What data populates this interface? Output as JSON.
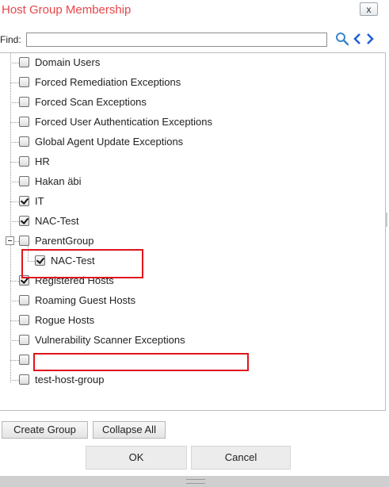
{
  "dialog": {
    "title": "Host Group Membership",
    "close_label": "x"
  },
  "find": {
    "label": "Find:",
    "value": "",
    "placeholder": "",
    "icons": [
      "search-icon",
      "previous-icon",
      "next-icon"
    ]
  },
  "tree": {
    "items": [
      {
        "label": "Domain Users",
        "checked": false
      },
      {
        "label": "Forced Remediation Exceptions",
        "checked": false
      },
      {
        "label": "Forced Scan Exceptions",
        "checked": false
      },
      {
        "label": "Forced User Authentication Exceptions",
        "checked": false
      },
      {
        "label": "Global Agent Update Exceptions",
        "checked": false
      },
      {
        "label": "HR",
        "checked": false
      },
      {
        "label": "Hakan äbi",
        "checked": false
      },
      {
        "label": "IT",
        "checked": true
      },
      {
        "label": "NAC-Test",
        "checked": true
      },
      {
        "label": "ParentGroup",
        "checked": false,
        "expanded": true,
        "children": [
          {
            "label": "NAC-Test",
            "checked": true
          }
        ]
      },
      {
        "label": "Registered Hosts",
        "checked": true
      },
      {
        "label": "Roaming Guest Hosts",
        "checked": false
      },
      {
        "label": "Rogue Hosts",
        "checked": false
      },
      {
        "label": "Vulnerability Scanner Exceptions",
        "checked": false
      },
      {
        "label": "",
        "checked": false
      },
      {
        "label": "test-host-group",
        "checked": false
      }
    ]
  },
  "buttons": {
    "create_group": "Create Group",
    "collapse_all": "Collapse All",
    "ok": "OK",
    "cancel": "Cancel"
  },
  "colors": {
    "title": "#e8454a",
    "highlight": "#e0141c"
  }
}
